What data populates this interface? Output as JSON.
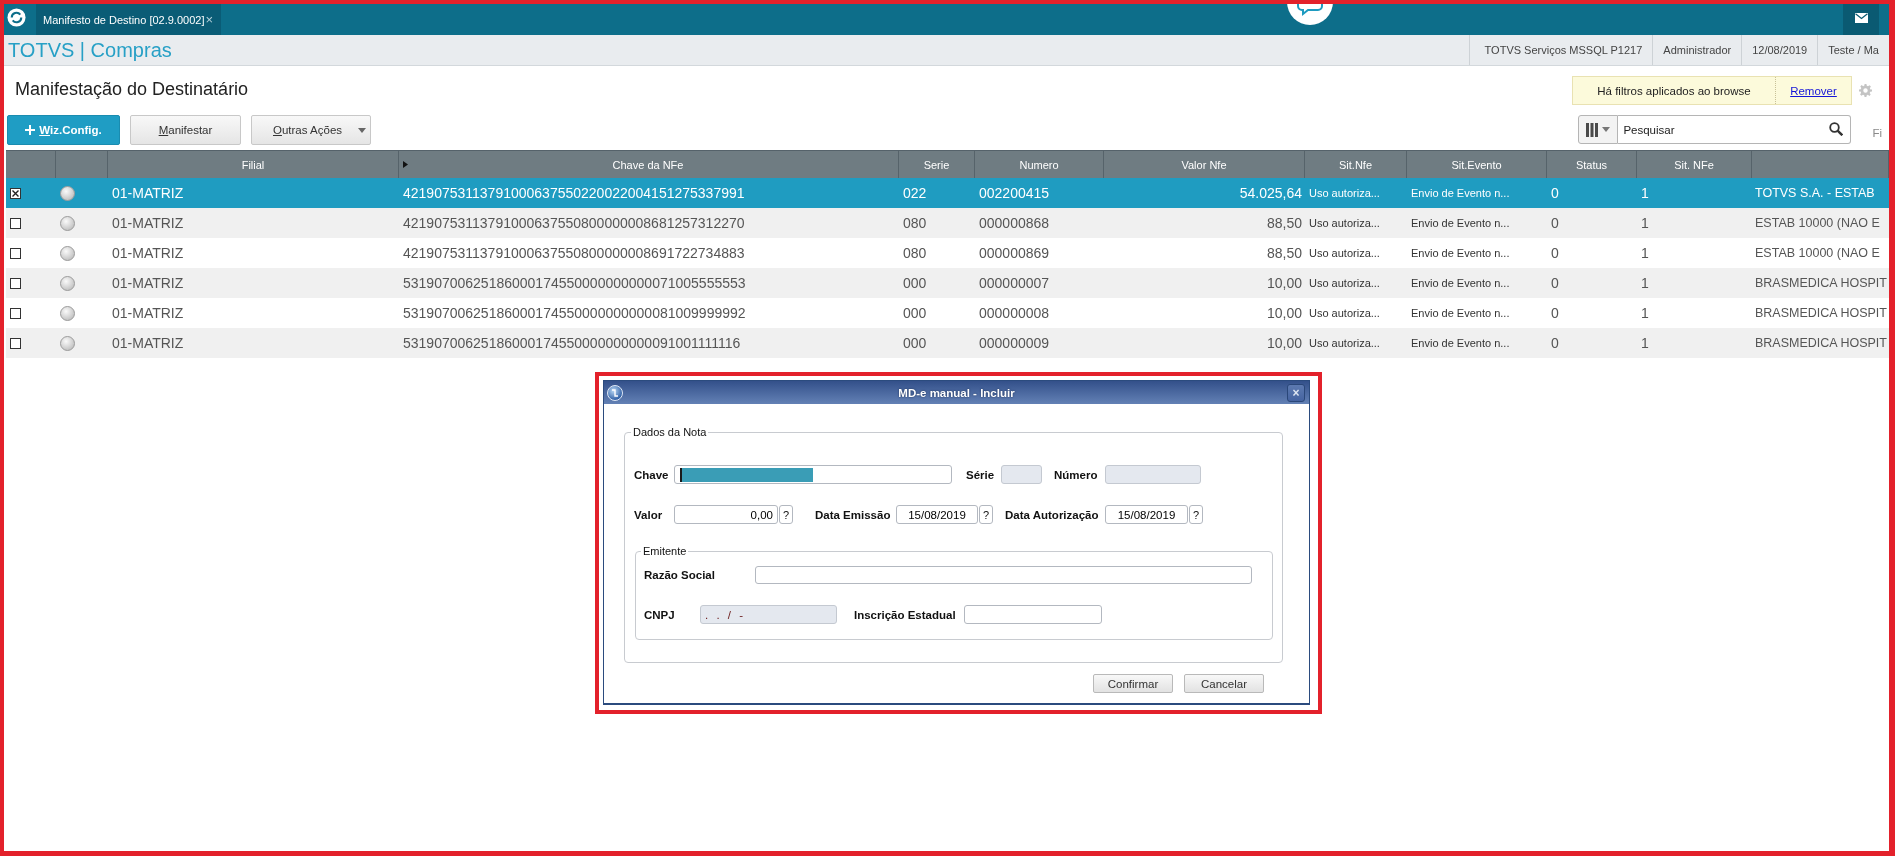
{
  "highlighted": true,
  "top_bar": {
    "tab": {
      "label": "Manifesto de Destino [02.9.0002]",
      "close": "×",
      "selected": true
    }
  },
  "header": {
    "brand": "TOTVS | Compras",
    "info": [
      "TOTVS Serviços MSSQL P1217",
      "Administrador",
      "12/08/2019",
      "Teste / Ma"
    ]
  },
  "page": {
    "title": "Manifestação do Destinatário",
    "filter_notice": {
      "text": "Há filtros aplicados ao browse",
      "link": "Remover"
    }
  },
  "actions": [
    {
      "label": "Wiz.Config.",
      "kind": "primary",
      "mnemonic": true
    },
    {
      "label": "Manifestar",
      "kind": "secondary",
      "mnemonic": true
    },
    {
      "label": "Outras Ações",
      "kind": "dropdown",
      "mnemonic": true
    }
  ],
  "search": {
    "placeholder": "Pesquisar"
  },
  "cut_label": "Fi",
  "table": {
    "columns": [
      {
        "label": "Filial",
        "kind": "text",
        "marker": false
      },
      {
        "label": "Chave da NFe",
        "kind": "text",
        "marker": true
      },
      {
        "label": "Serie",
        "kind": "text",
        "marker": false
      },
      {
        "label": "Numero",
        "kind": "text",
        "marker": false
      },
      {
        "label": "Valor Nfe",
        "kind": "money",
        "marker": false
      },
      {
        "label": "Sit.Nfe",
        "kind": "compact",
        "marker": false
      },
      {
        "label": "Sit.Evento",
        "kind": "compact",
        "marker": false
      },
      {
        "label": "Status",
        "kind": "text",
        "marker": false
      },
      {
        "label": "Sit. NFe",
        "kind": "text",
        "marker": false
      },
      {
        "kind": "name"
      }
    ],
    "rows": [
      {
        "selected": true,
        "checked": true,
        "cells": [
          "01-MATRIZ",
          "42190753113791000637550220022004151275337991",
          "022",
          "002200415",
          "54.025,64",
          "Uso autoriza...",
          "Envio de Evento n...",
          "0",
          "1",
          "TOTVS S.A. - ESTAB"
        ]
      },
      {
        "selected": false,
        "checked": false,
        "cells": [
          "01-MATRIZ",
          "42190753113791000637550800000008681257312270",
          "080",
          "000000868",
          "88,50",
          "Uso autoriza...",
          "Envio de Evento n...",
          "0",
          "1",
          "ESTAB 10000 (NAO E"
        ]
      },
      {
        "selected": false,
        "checked": false,
        "cells": [
          "01-MATRIZ",
          "42190753113791000637550800000008691722734883",
          "080",
          "000000869",
          "88,50",
          "Uso autoriza...",
          "Envio de Evento n...",
          "0",
          "1",
          "ESTAB 10000 (NAO E"
        ]
      },
      {
        "selected": false,
        "checked": false,
        "cells": [
          "01-MATRIZ",
          "53190700625186000174550000000000071005555553",
          "000",
          "000000007",
          "10,00",
          "Uso autoriza...",
          "Envio de Evento n...",
          "0",
          "1",
          "BRASMEDICA HOSPIT"
        ]
      },
      {
        "selected": false,
        "checked": false,
        "cells": [
          "01-MATRIZ",
          "53190700625186000174550000000000081009999992",
          "000",
          "000000008",
          "10,00",
          "Uso autoriza...",
          "Envio de Evento n...",
          "0",
          "1",
          "BRASMEDICA HOSPIT"
        ]
      },
      {
        "selected": false,
        "checked": false,
        "cells": [
          "01-MATRIZ",
          "53190700625186000174550000000000091001111116",
          "000",
          "000000009",
          "10,00",
          "Uso autoriza...",
          "Envio de Evento n...",
          "0",
          "1",
          "BRASMEDICA HOSPIT"
        ]
      }
    ]
  },
  "dialog": {
    "highlighted": true,
    "title": "MD-e manual - Incluir",
    "close": "×",
    "dados_da_nota": {
      "legend": "Dados da Nota",
      "chave": {
        "label": "Chave",
        "selected": true,
        "disabled": false
      },
      "serie": {
        "label": "Série",
        "disabled": true
      },
      "numero": {
        "label": "Número",
        "disabled": true
      },
      "valor": {
        "label": "Valor",
        "value": "0,00",
        "help": "?",
        "disabled": false
      },
      "data_emissao": {
        "label": "Data Emissão",
        "value": "15/08/2019",
        "help": "?",
        "disabled": false
      },
      "data_autorizacao": {
        "label": "Data Autorização",
        "value": "15/08/2019",
        "help": "?",
        "disabled": false
      },
      "emitente": {
        "legend": "Emitente",
        "razao_social": {
          "label": "Razão Social",
          "disabled": false
        },
        "cnpj": {
          "label": "CNPJ",
          "value": ". . / -",
          "disabled": true
        },
        "inscricao_estadual": {
          "label": "Inscrição Estadual",
          "disabled": false
        }
      }
    },
    "buttons": [
      "Confirmar",
      "Cancelar"
    ]
  }
}
